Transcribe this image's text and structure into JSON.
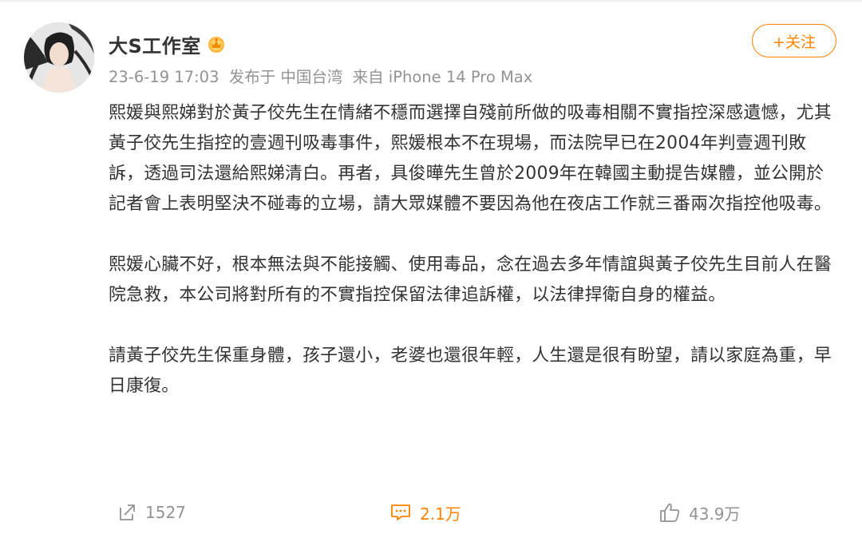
{
  "author": {
    "name": "大S工作室",
    "badge_icon": "vip-crown-icon"
  },
  "meta": {
    "time": "23-6-19 17:03",
    "location": "发布于 中国台湾",
    "source": "来自 iPhone 14 Pro Max"
  },
  "follow_button": "+关注",
  "content": {
    "paragraphs": [
      "熙媛與熙娣對於黃子佼先生在情緒不穩而選擇自殘前所做的吸毒相關不實指控深感遺憾，尤其黃子佼先生指控的壹週刊吸毒事件，熙媛根本不在現場，而法院早已在2004年判壹週刊敗訴，透過司法還給熙娣清白。再者，具俊曄先生曾於2009年在韓國主動提告媒體，並公開於記者會上表明堅決不碰毒的立場，請大眾媒體不要因為他在夜店工作就三番兩次指控他吸毒。",
      "熙媛心臟不好，根本無法與不能接觸、使用毒品，念在過去多年情誼與黃子佼先生目前人在醫院急救，本公司將對所有的不實指控保留法律追訴權，以法律捍衛自身的權益。",
      "請黃子佼先生保重身體，孩子還小，老婆也還很年輕，人生還是很有盼望，請以家庭為重，早日康復。"
    ]
  },
  "actions": {
    "repost": {
      "icon": "repost-icon",
      "count": "1527"
    },
    "comment": {
      "icon": "comment-icon",
      "count": "2.1万"
    },
    "like": {
      "icon": "thumbs-up-icon",
      "count": "43.9万"
    }
  },
  "colors": {
    "accent": "#ff8200",
    "text": "#333333",
    "muted": "#939393"
  }
}
